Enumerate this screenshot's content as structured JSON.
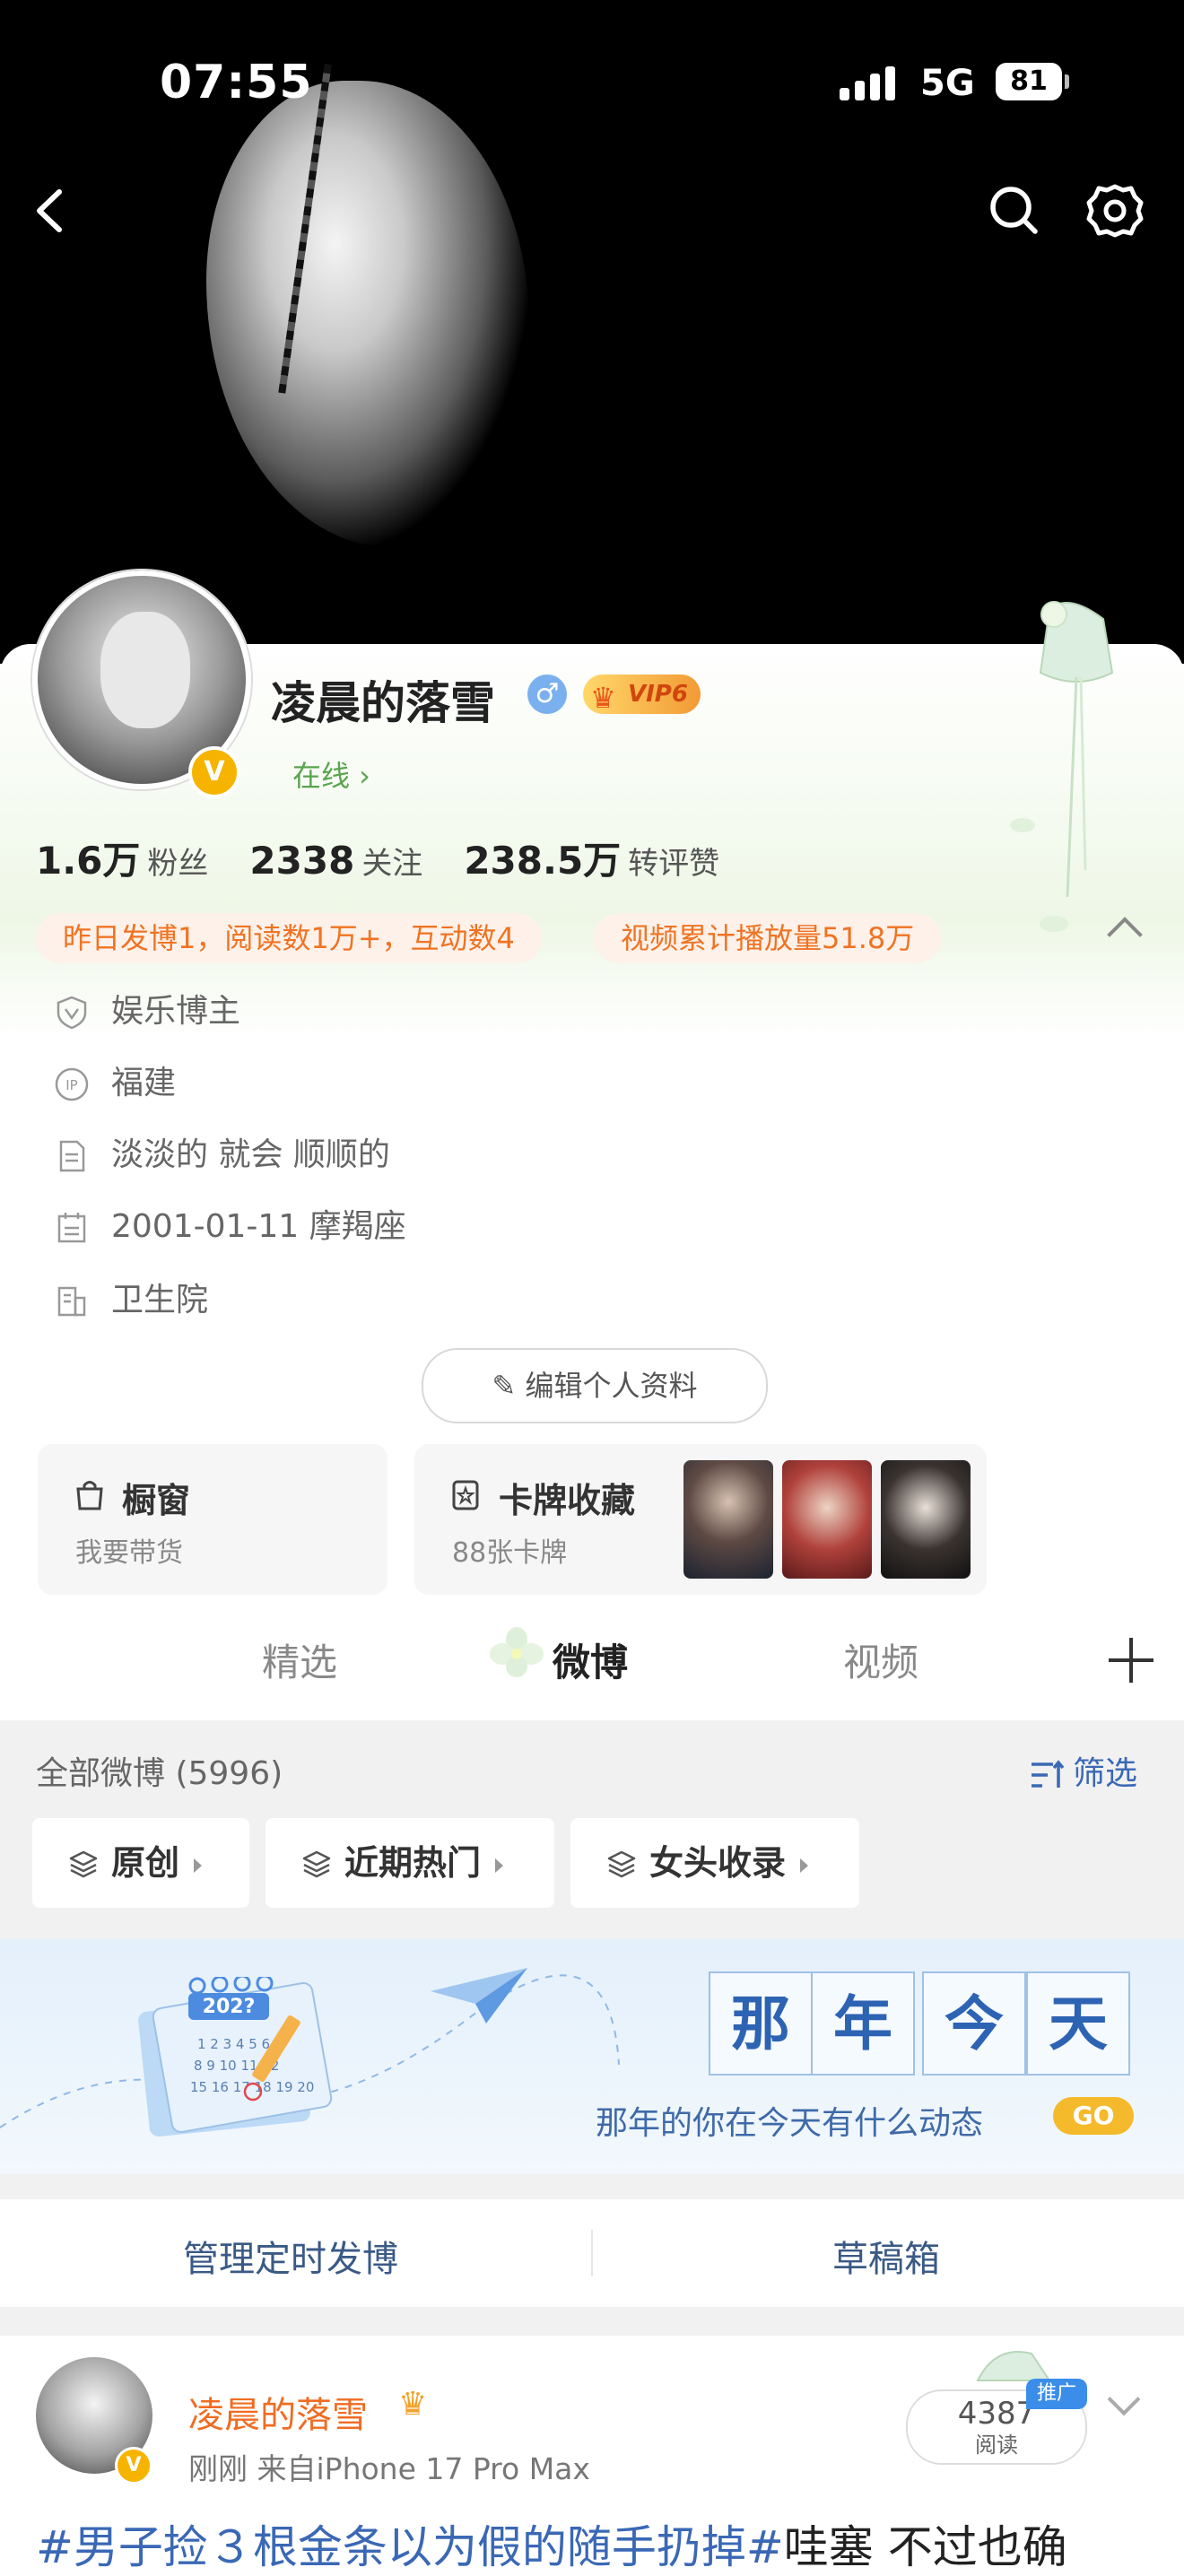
{
  "status_bar": {
    "time": "07:55",
    "network": "5G",
    "battery": "81"
  },
  "profile": {
    "name": "凌晨的落雪",
    "gender_symbol": "♂",
    "vip_label": "VIP6",
    "status_link": "在线 ›",
    "stats": [
      {
        "value": "1.6万",
        "label": "粉丝"
      },
      {
        "value": "2338",
        "label": "关注"
      },
      {
        "value": "238.5万",
        "label": "转评赞"
      }
    ],
    "pills": [
      "昨日发博1，阅读数1万+，互动数4",
      "视频累计播放量51.8万"
    ],
    "info": [
      {
        "icon": "shield-v-icon",
        "text": "娱乐博主"
      },
      {
        "icon": "ip-location-icon",
        "text": "福建"
      },
      {
        "icon": "document-icon",
        "text": "淡淡的 就会 顺顺的"
      },
      {
        "icon": "calendar-icon",
        "text": "2001-01-11 摩羯座"
      },
      {
        "icon": "building-icon",
        "text": "卫生院"
      }
    ],
    "edit_button": "编辑个人资料"
  },
  "shop_box": {
    "title": "橱窗",
    "subtitle": "我要带货"
  },
  "cards_box": {
    "title": "卡牌收藏",
    "subtitle": "88张卡牌"
  },
  "tabs": [
    "精选",
    "微博",
    "视频"
  ],
  "active_tab": "微博",
  "feed": {
    "all_count": "全部微博 (5996)",
    "filter_label": "筛选",
    "chips": [
      "原创",
      "近期热门",
      "女头收录"
    ]
  },
  "banner": {
    "calendar_year": "202?",
    "chars": [
      "那",
      "年",
      "今",
      "天"
    ],
    "subtitle": "那年的你在今天有什么动态",
    "go_label": "GO"
  },
  "manage": {
    "left": "管理定时发博",
    "right": "草稿箱"
  },
  "post": {
    "author": "凌晨的落雪",
    "time": "刚刚",
    "source": "来自iPhone 17 Pro Max",
    "reads_count": "4387",
    "reads_label": "阅读",
    "promo_badge": "推广",
    "hashtag": "#男子捡３根金条以为假的随手扔掉#",
    "text_rest": "哇塞 不过也确"
  },
  "colors": {
    "accent_orange": "#f07322",
    "link_blue": "#3a68b5",
    "online_green": "#5aa44f",
    "vip_gold": "#f39a35"
  }
}
